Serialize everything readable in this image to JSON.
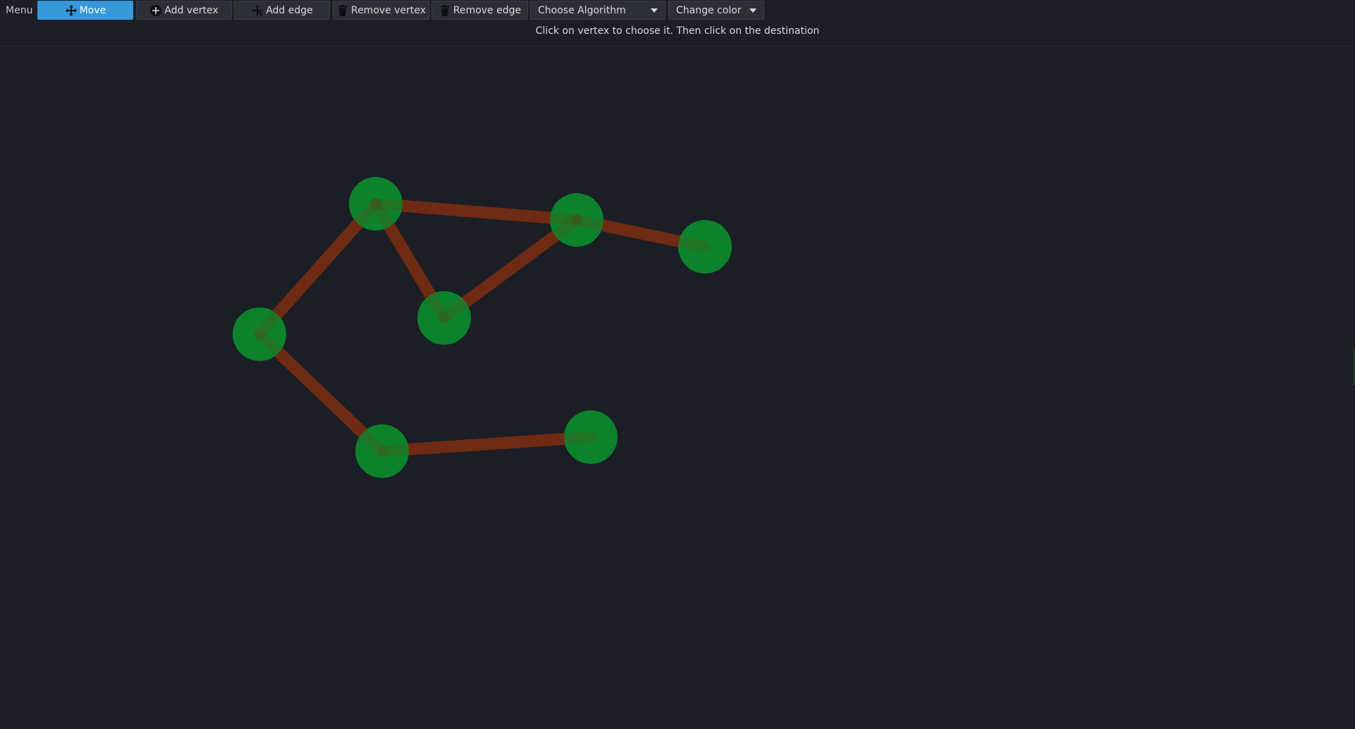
{
  "menu": {
    "label": "Menu"
  },
  "toolbar": {
    "buttons": [
      {
        "label": "Move",
        "icon": "move-icon",
        "active": true
      },
      {
        "label": "Add vertex",
        "icon": "add-circle-icon",
        "active": false
      },
      {
        "label": "Add edge",
        "icon": "add-edge-icon",
        "active": false
      },
      {
        "label": "Remove vertex",
        "icon": "trash-icon",
        "active": false
      },
      {
        "label": "Remove edge",
        "icon": "trash-icon",
        "active": false
      }
    ],
    "algorithm_select": {
      "value": "Choose Algorithm"
    },
    "color_select": {
      "value": "Change color"
    }
  },
  "hint": "Click on vertex to choose it. Then click on the destination",
  "graph": {
    "colors": {
      "background": "#1b1e25",
      "vertex": "#0a8a2c",
      "edge": "#6e2a12",
      "accent": "#3498db"
    },
    "vertices": [
      {
        "id": "v1"
      },
      {
        "id": "v2"
      },
      {
        "id": "v3"
      },
      {
        "id": "v4"
      },
      {
        "id": "v5"
      },
      {
        "id": "v6"
      },
      {
        "id": "v7"
      }
    ],
    "edges": [
      {
        "from": "v1",
        "to": "v2"
      },
      {
        "from": "v1",
        "to": "v3"
      },
      {
        "from": "v1",
        "to": "v4"
      },
      {
        "from": "v2",
        "to": "v3"
      },
      {
        "from": "v2",
        "to": "v5"
      },
      {
        "from": "v4",
        "to": "v6"
      },
      {
        "from": "v6",
        "to": "v7"
      }
    ]
  }
}
